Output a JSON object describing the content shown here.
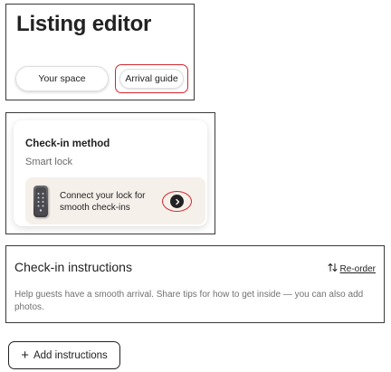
{
  "header": {
    "title": "Listing editor",
    "tabs": [
      {
        "label": "Your space",
        "active": false
      },
      {
        "label": "Arrival guide",
        "active": true
      }
    ]
  },
  "checkin_method": {
    "title": "Check-in method",
    "value": "Smart lock",
    "promo": {
      "text": "Connect your lock for smooth check-ins",
      "icon": "smart-lock-icon",
      "action_icon": "chevron-right-icon"
    }
  },
  "checkin_instructions": {
    "title": "Check-in instructions",
    "reorder_label": "Re-order",
    "reorder_icon": "reorder-arrows-icon",
    "description": "Help guests have a smooth arrival. Share tips for how to get inside — you can also add photos."
  },
  "add_button": {
    "icon": "plus-icon",
    "plus_glyph": "+",
    "label": "Add instructions"
  },
  "colors": {
    "highlight": "#d0262f",
    "text": "#222222",
    "muted": "#717171",
    "promo_bg": "#f6f0ea"
  }
}
